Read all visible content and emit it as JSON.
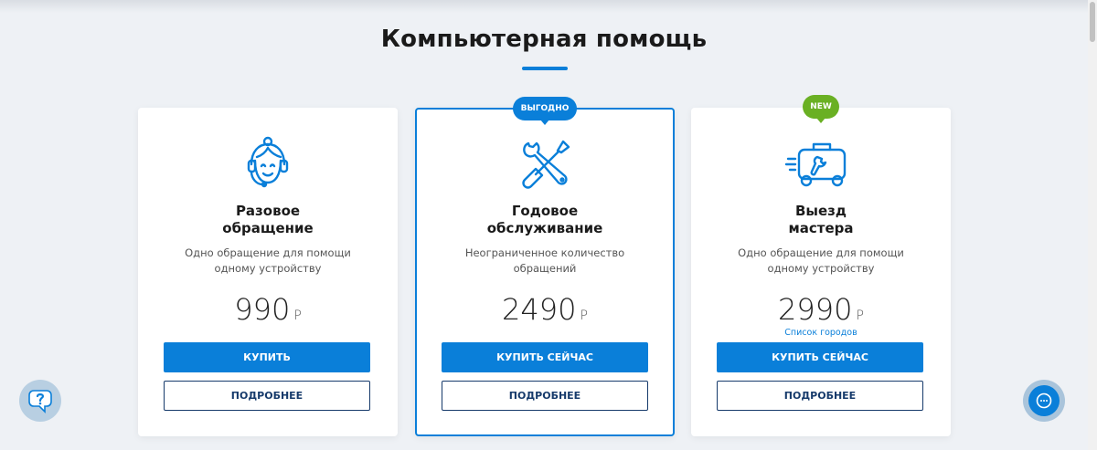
{
  "page": {
    "title": "Компьютерная помощь",
    "accent_color": "#0a7fd9"
  },
  "cards": [
    {
      "icon": "headset-operator-icon",
      "title_line1": "Разовое",
      "title_line2": "обращение",
      "description": "Одно обращение для помощи одному устройству",
      "price": "990",
      "currency": "Р",
      "primary_button": "КУПИТЬ",
      "secondary_button": "ПОДРОБНЕЕ"
    },
    {
      "badge": "ВЫГОДНО",
      "icon": "wrench-screwdriver-icon",
      "title_line1": "Годовое",
      "title_line2": "обслуживание",
      "description": "Неограниченное количество обращений",
      "price": "2490",
      "currency": "Р",
      "primary_button": "КУПИТЬ СЕЙЧАС",
      "secondary_button": "ПОДРОБНЕЕ"
    },
    {
      "badge": "NEW",
      "icon": "toolbox-van-icon",
      "title_line1": "Выезд",
      "title_line2": "мастера",
      "description": "Одно обращение для помощи одному устройству",
      "price": "2990",
      "currency": "Р",
      "cities_link": "Список городов",
      "primary_button": "КУПИТЬ СЕЙЧАС",
      "secondary_button": "ПОДРОБНЕЕ"
    }
  ],
  "widgets": {
    "help_icon": "question-bubble-icon",
    "chat_icon": "chat-bubble-icon"
  }
}
